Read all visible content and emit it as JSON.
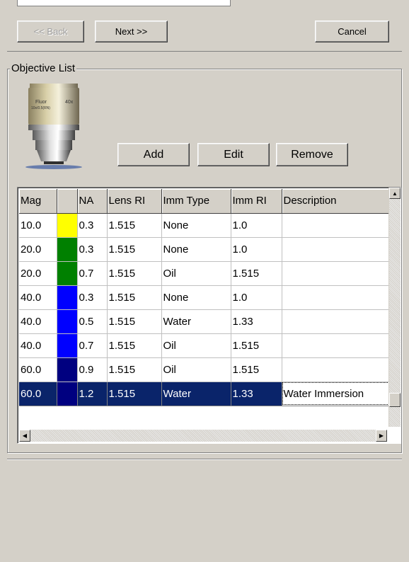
{
  "nav": {
    "back_label": "<< Back",
    "next_label": "Next >>",
    "cancel_label": "Cancel"
  },
  "objective_list": {
    "title": "Objective List",
    "lens_image_text": [
      "Fluor",
      "40x",
      "10x/0.5(RN)"
    ],
    "buttons": {
      "add": "Add",
      "edit": "Edit",
      "remove": "Remove"
    },
    "columns": [
      "Mag",
      "",
      "NA",
      "Lens RI",
      "Imm Type",
      "Imm RI",
      "Description"
    ],
    "rows": [
      {
        "mag": "10.0",
        "color": "#ffff00",
        "na": "0.3",
        "lens_ri": "1.515",
        "imm_type": "None",
        "imm_ri": "1.0",
        "description": ""
      },
      {
        "mag": "20.0",
        "color": "#008000",
        "na": "0.3",
        "lens_ri": "1.515",
        "imm_type": "None",
        "imm_ri": "1.0",
        "description": ""
      },
      {
        "mag": "20.0",
        "color": "#008000",
        "na": "0.7",
        "lens_ri": "1.515",
        "imm_type": "Oil",
        "imm_ri": "1.515",
        "description": ""
      },
      {
        "mag": "40.0",
        "color": "#0000ff",
        "na": "0.3",
        "lens_ri": "1.515",
        "imm_type": "None",
        "imm_ri": "1.0",
        "description": ""
      },
      {
        "mag": "40.0",
        "color": "#0000ff",
        "na": "0.5",
        "lens_ri": "1.515",
        "imm_type": "Water",
        "imm_ri": "1.33",
        "description": ""
      },
      {
        "mag": "40.0",
        "color": "#0000ff",
        "na": "0.7",
        "lens_ri": "1.515",
        "imm_type": "Oil",
        "imm_ri": "1.515",
        "description": ""
      },
      {
        "mag": "60.0",
        "color": "#000080",
        "na": "0.9",
        "lens_ri": "1.515",
        "imm_type": "Oil",
        "imm_ri": "1.515",
        "description": ""
      },
      {
        "mag": "60.0",
        "color": "#000080",
        "na": "1.2",
        "lens_ri": "1.515",
        "imm_type": "Water",
        "imm_ri": "1.33",
        "description": "Water Immersion",
        "selected": true
      }
    ]
  },
  "colors": {
    "selection": "#0a246a",
    "face": "#d4d0c8"
  }
}
